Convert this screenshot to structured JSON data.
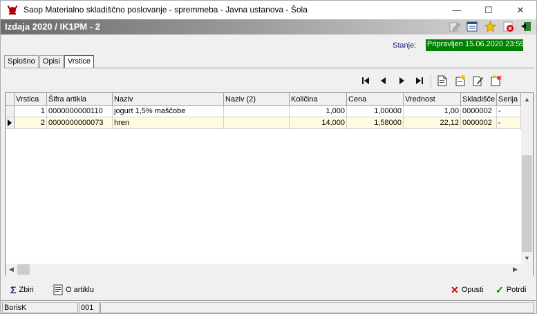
{
  "window": {
    "title": "Saop Materialno skladiščno poslovanje - spremmeba - Javna ustanova - Šola",
    "min_glyph": "—",
    "max_glyph": "☐",
    "close_glyph": "✕"
  },
  "form": {
    "title": "Izdaja 2020 / IK1PM - 2",
    "tool_icons": [
      "edit-icon",
      "form-icon",
      "favorite-icon",
      "close-form-icon",
      "exit-icon"
    ]
  },
  "status": {
    "label": "Stanje:",
    "value": "Pripravljen 15.06.2020 23:59",
    "value_color": "#008000"
  },
  "tabs": [
    {
      "label": "Splošno",
      "active": false
    },
    {
      "label": "Opisi",
      "active": false
    },
    {
      "label": "Vrstice",
      "active": true
    }
  ],
  "grid": {
    "columns": [
      "Vrstica",
      "Šifra artikla",
      "Naziv",
      "Naziv (2)",
      "Količina",
      "Cena",
      "Vrednost",
      "Skladišče",
      "Serija"
    ],
    "rows": [
      {
        "vrstica": "1",
        "sifra": "0000000000110",
        "naziv": "jogurt 1,5% maščobe",
        "naziv2": "",
        "kolicina": "1,000",
        "cena": "1,00000",
        "vrednost": "1,00",
        "skladisce": "0000002",
        "serija": "-"
      },
      {
        "vrstica": "2",
        "sifra": "0000000000073",
        "naziv": "hren",
        "naziv2": "",
        "kolicina": "14,000",
        "cena": "1,58000",
        "vrednost": "22,12",
        "skladisce": "0000002",
        "serija": "-"
      }
    ],
    "selected_row": 2
  },
  "buttons": {
    "zbiri": "Zbiri",
    "o_artiklu": "O artiklu",
    "opusti": "Opusti",
    "potrdi": "Potrdi"
  },
  "statusbar": {
    "user": "BorisK",
    "code": "001"
  }
}
